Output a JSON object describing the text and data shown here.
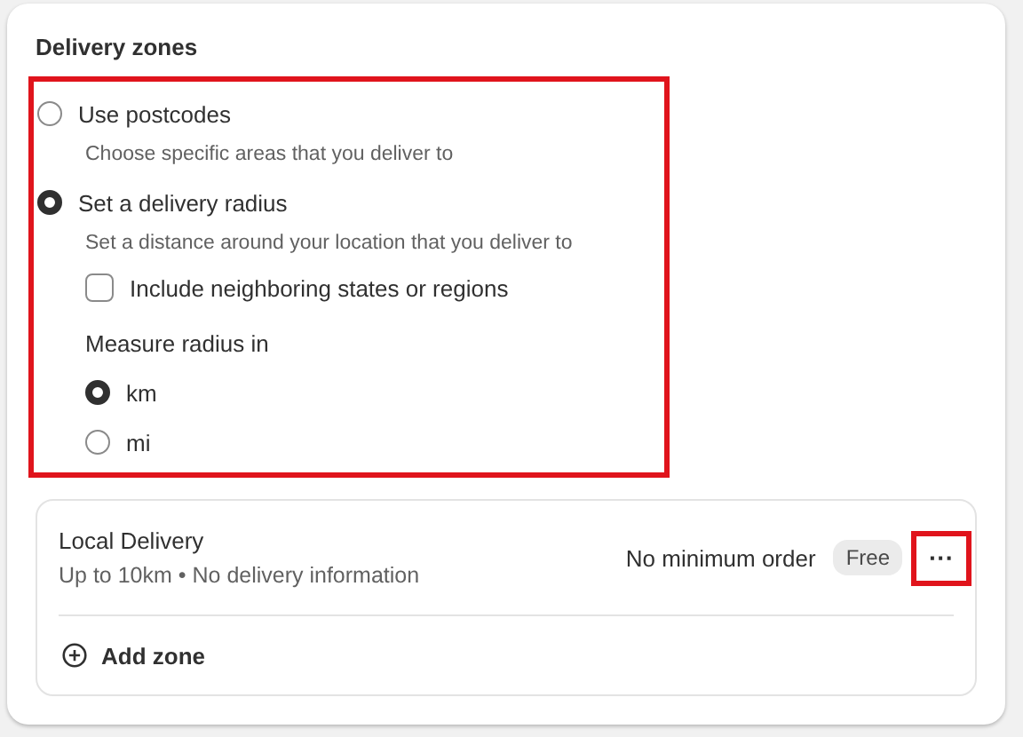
{
  "section": {
    "title": "Delivery zones"
  },
  "zone_method": [
    {
      "label": "Use postcodes",
      "description": "Choose specific areas that you deliver to",
      "selected": false
    },
    {
      "label": "Set a delivery radius",
      "description": "Set a distance around your location that you deliver to",
      "selected": true
    }
  ],
  "include_neighbors": {
    "label": "Include neighboring states or regions",
    "checked": false
  },
  "measure": {
    "label": "Measure radius in",
    "units": [
      {
        "label": "km",
        "selected": true
      },
      {
        "label": "mi",
        "selected": false
      }
    ]
  },
  "zones": [
    {
      "name": "Local Delivery",
      "details": "Up to 10km • No delivery information",
      "minimum": "No minimum order",
      "price": "Free",
      "menu": "···"
    }
  ],
  "add_zone": {
    "label": "Add zone"
  }
}
